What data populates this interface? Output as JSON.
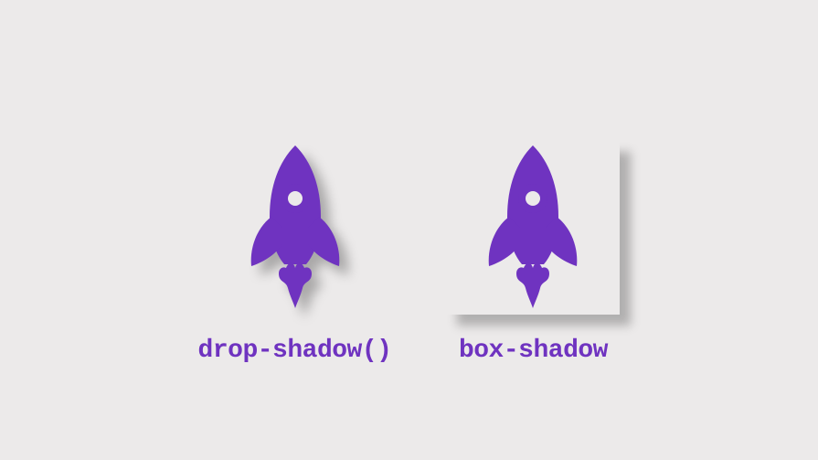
{
  "accent_color": "#6f33c0",
  "examples": [
    {
      "label": "drop-shadow()"
    },
    {
      "label": "box-shadow"
    }
  ]
}
